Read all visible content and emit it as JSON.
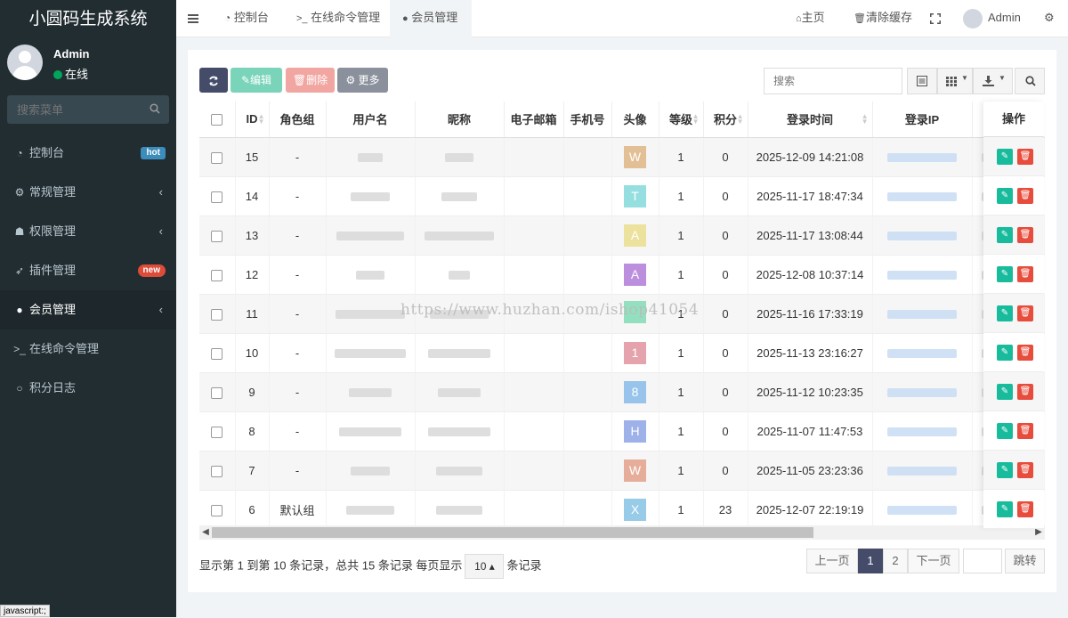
{
  "app": {
    "title": "小圆码生成系统"
  },
  "user": {
    "name": "Admin",
    "status": "在线"
  },
  "sidebar": {
    "search_placeholder": "搜索菜单",
    "items": [
      {
        "label": "控制台",
        "icon": "dashboard-icon",
        "badge": "hot"
      },
      {
        "label": "常规管理",
        "icon": "cogs-icon"
      },
      {
        "label": "权限管理",
        "icon": "group-icon"
      },
      {
        "label": "插件管理",
        "icon": "rocket-icon",
        "badge": "new"
      },
      {
        "label": "会员管理",
        "icon": "user-circle-icon",
        "active": true
      },
      {
        "label": "在线命令管理",
        "icon": "terminal-icon"
      },
      {
        "label": "积分日志",
        "icon": "circle-icon"
      }
    ]
  },
  "topbar": {
    "tabs": [
      {
        "label": "控制台",
        "icon": "dashboard-icon"
      },
      {
        "label": "在线命令管理",
        "icon": "terminal-icon"
      },
      {
        "label": "会员管理",
        "icon": "user-icon",
        "active": true
      }
    ],
    "home": "主页",
    "clear_cache": "清除缓存",
    "admin": "Admin"
  },
  "toolbar": {
    "edit": "编辑",
    "delete": "删除",
    "more": "更多",
    "search_placeholder": "搜索"
  },
  "table": {
    "columns": [
      "ID",
      "角色组",
      "用户名",
      "昵称",
      "电子邮箱",
      "手机号",
      "头像",
      "等级",
      "积分",
      "登录时间",
      "登录IP",
      "操作"
    ],
    "rows": [
      {
        "id": "15",
        "group": "-",
        "avatar": "W",
        "avatar_color": "#e3bf95",
        "level": "1",
        "score": "0",
        "login_time": "2025-12-09 14:21:08"
      },
      {
        "id": "14",
        "group": "-",
        "avatar": "T",
        "avatar_color": "#95dfe0",
        "level": "1",
        "score": "0",
        "login_time": "2025-11-17 18:47:34"
      },
      {
        "id": "13",
        "group": "-",
        "avatar": "A",
        "avatar_color": "#ece29d",
        "level": "1",
        "score": "0",
        "login_time": "2025-11-17 13:08:44"
      },
      {
        "id": "12",
        "group": "-",
        "avatar": "A",
        "avatar_color": "#bb8fde",
        "level": "1",
        "score": "0",
        "login_time": "2025-12-08 10:37:14"
      },
      {
        "id": "11",
        "group": "-",
        "avatar": "",
        "avatar_color": "#93e0c0",
        "level": "1",
        "score": "0",
        "login_time": "2025-11-16 17:33:19"
      },
      {
        "id": "10",
        "group": "-",
        "avatar": "1",
        "avatar_color": "#e5a4ad",
        "level": "1",
        "score": "0",
        "login_time": "2025-11-13 23:16:27"
      },
      {
        "id": "9",
        "group": "-",
        "avatar": "8",
        "avatar_color": "#98c3ea",
        "level": "1",
        "score": "0",
        "login_time": "2025-11-12 10:23:35"
      },
      {
        "id": "8",
        "group": "-",
        "avatar": "H",
        "avatar_color": "#9eb1e8",
        "level": "1",
        "score": "0",
        "login_time": "2025-11-07 11:47:53"
      },
      {
        "id": "7",
        "group": "-",
        "avatar": "W",
        "avatar_color": "#e6ad9b",
        "level": "1",
        "score": "0",
        "login_time": "2025-11-05 23:23:36"
      },
      {
        "id": "6",
        "group": "默认组",
        "avatar": "X",
        "avatar_color": "#97cbe8",
        "level": "1",
        "score": "23",
        "login_time": "2025-12-07 22:19:19"
      }
    ]
  },
  "pagination": {
    "info_prefix": "显示第 1 到第 10 条记录，总共 15 条记录 每页显示",
    "page_size": "10",
    "info_suffix": "条记录",
    "prev": "上一页",
    "pages": [
      "1",
      "2"
    ],
    "next": "下一页",
    "jump": "跳转"
  },
  "status_tip": "javascript:;",
  "watermark": "https://www.huzhan.com/ishop41054"
}
